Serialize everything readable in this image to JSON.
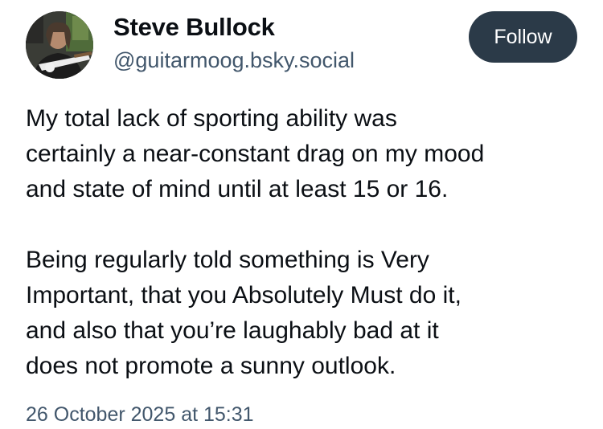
{
  "author": {
    "display_name": "Steve Bullock",
    "handle": "@guitarmoog.bsky.social",
    "avatar": "avatar-photo-guitarist"
  },
  "follow_button": {
    "label": "Follow"
  },
  "post": {
    "paragraphs": [
      "My total lack of sporting ability was\ncertainly a near-constant drag on my mood\nand state of mind until at least 15 or 16.",
      "Being regularly told something is Very\nImportant, that you Absolutely Must do it,\nand also that you’re laughably bad at it\ndoes not promote a sunny outlook."
    ],
    "timestamp": "26 October 2025 at 15:31"
  },
  "colors": {
    "name_text": "#0b0f14",
    "secondary_text": "#42576c",
    "follow_button_bg": "#2b3a48",
    "follow_button_text": "#ffffff",
    "background": "#ffffff"
  }
}
